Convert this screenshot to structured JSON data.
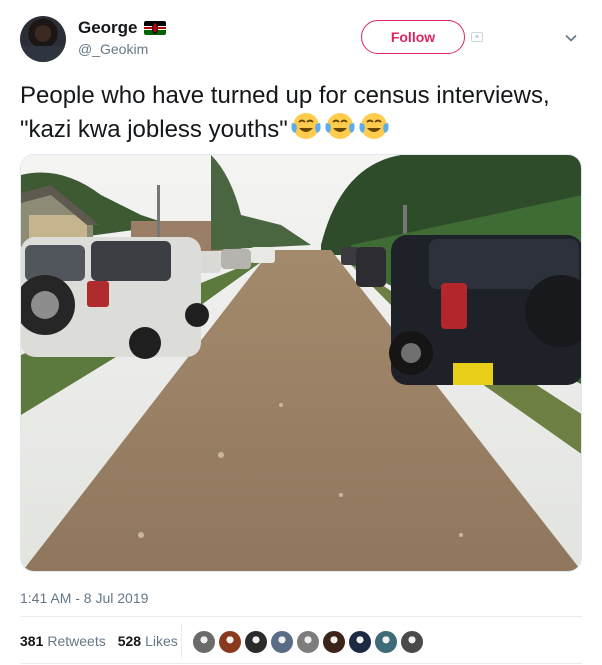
{
  "user": {
    "display_name": "George",
    "handle": "@_Geokim",
    "flag": "kenya-flag"
  },
  "follow_button_label": "Follow",
  "tweet": {
    "text": "People who have turned up for census interviews, \"kazi kwa jobless youths\"",
    "emojis": [
      "face-with-tears-of-joy-emoji",
      "face-with-tears-of-joy-emoji",
      "face-with-tears-of-joy-emoji"
    ]
  },
  "timestamp": "1:41 AM - 8 Jul 2019",
  "stats": {
    "retweets_count": "381",
    "retweets_label": "Retweets",
    "likes_count": "528",
    "likes_label": "Likes"
  },
  "liker_avatars": [
    "#6b6b6b",
    "#8a3a1c",
    "#2b2b2b",
    "#5a6b85",
    "#7d7d7d",
    "#3b2418",
    "#1d2940",
    "#3e6b78",
    "#4a4a4a"
  ],
  "colors": {
    "accent": "#e0245e",
    "muted_text": "#657786",
    "text": "#14171a"
  }
}
